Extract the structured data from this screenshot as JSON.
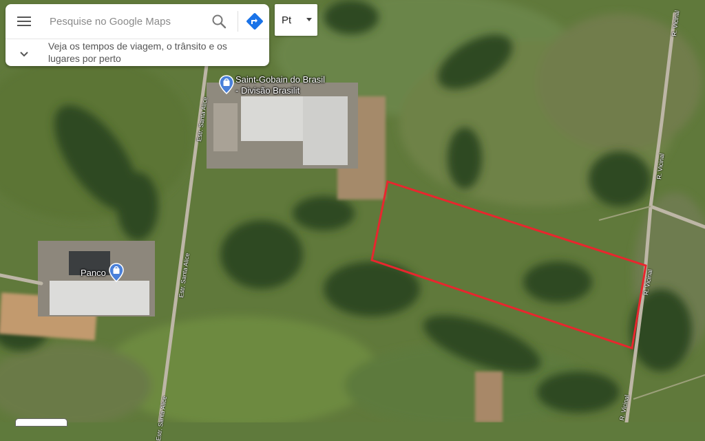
{
  "search": {
    "placeholder": "Pesquise no Google Maps",
    "hint": "Veja os tempos de viagem, o trânsito e os lugares por perto",
    "menu_icon": "menu-icon",
    "search_icon": "search-icon",
    "directions_icon": "directions-icon",
    "expand_icon": "chevron-down-icon"
  },
  "language_selector": {
    "value": "Pt"
  },
  "places": [
    {
      "name": "Saint-Gobain do Brasil - Divisão Brasilit",
      "line1": "Saint-Gobain do Brasil",
      "line2": "- Divisão Brasilit",
      "icon": "shopping-bag-pin-icon"
    },
    {
      "name": "Panco",
      "icon": "shopping-bag-pin-icon"
    }
  ],
  "roads": {
    "santa_alice_1": "Estr. Santa Alice",
    "santa_alice_2": "Estr. Santa Alice",
    "santa_alice_3": "Estr. Santa Alice",
    "vicinal_1": "R. Vicinal",
    "vicinal_2": "R. Vicinal",
    "vicinal_3": "R. Vicinal",
    "vicinal_4": "R. Vicinal"
  },
  "colors": {
    "highlight_outline": "#e8262e",
    "pin_blue": "#4a80d9",
    "directions_blue": "#1a73e8"
  }
}
